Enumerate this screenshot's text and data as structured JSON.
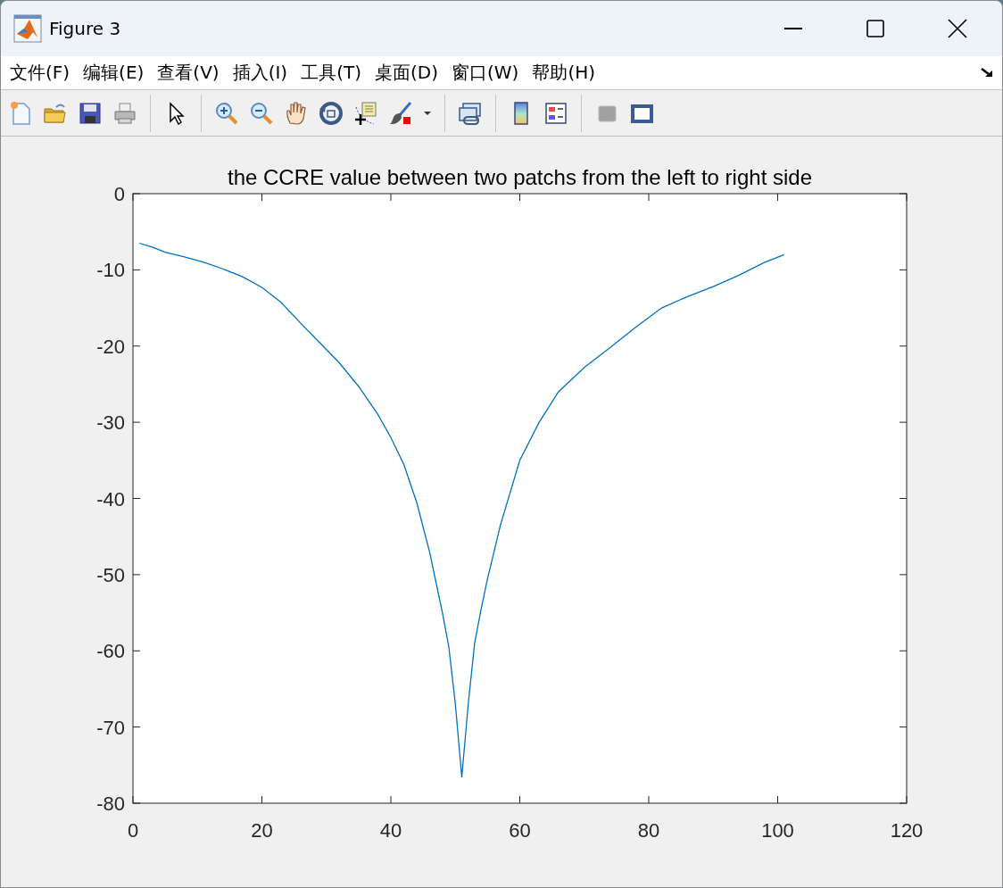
{
  "window": {
    "title": "Figure 3"
  },
  "menu": [
    {
      "label": "文件(F)"
    },
    {
      "label": "编辑(E)"
    },
    {
      "label": "查看(V)"
    },
    {
      "label": "插入(I)"
    },
    {
      "label": "工具(T)"
    },
    {
      "label": "桌面(D)"
    },
    {
      "label": "窗口(W)"
    },
    {
      "label": "帮助(H)"
    }
  ],
  "chart_data": {
    "type": "line",
    "title": "the CCRE value between two patchs from the left to right side",
    "xlim": [
      0,
      120
    ],
    "ylim": [
      -80,
      0
    ],
    "xticks": [
      0,
      20,
      40,
      60,
      80,
      100,
      120
    ],
    "yticks": [
      0,
      -10,
      -20,
      -30,
      -40,
      -50,
      -60,
      -70,
      -80
    ],
    "x": [
      1,
      3,
      5,
      8,
      11,
      14,
      17,
      20,
      23,
      26,
      29,
      32,
      35,
      38,
      40,
      42,
      44,
      46,
      48,
      49,
      50,
      51,
      52,
      53,
      54,
      55,
      57,
      60,
      63,
      66,
      70,
      74,
      78,
      82,
      86,
      90,
      94,
      98,
      101
    ],
    "series": [
      {
        "color": "#0072bd",
        "values": [
          -6.5,
          -7.0,
          -7.7,
          -8.3,
          -9.0,
          -9.9,
          -10.9,
          -12.3,
          -14.3,
          -17.0,
          -19.6,
          -22.2,
          -25.3,
          -29.0,
          -32.0,
          -35.5,
          -40.5,
          -47.0,
          -55.0,
          -59.5,
          -67.0,
          -76.6,
          -67.0,
          -59.0,
          -54.5,
          -50.5,
          -43.5,
          -35.0,
          -30.0,
          -26.0,
          -22.8,
          -20.2,
          -17.5,
          -15.0,
          -13.5,
          -12.2,
          -10.7,
          -9.0,
          -8.0
        ]
      }
    ]
  }
}
